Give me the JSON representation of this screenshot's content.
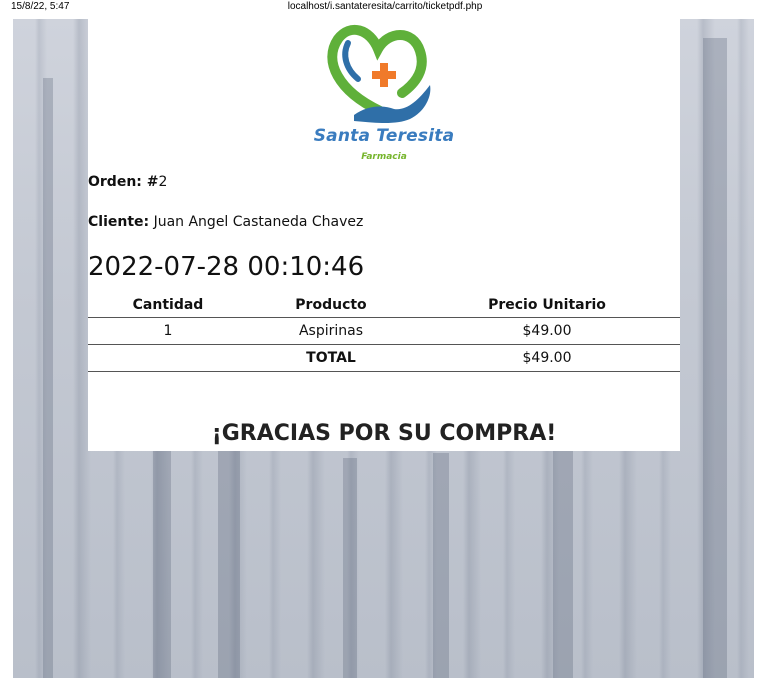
{
  "print_header": {
    "date": "15/8/22, 5:47",
    "url": "localhost/i.santateresita/carrito/ticketpdf.php"
  },
  "logo": {
    "brand": "Santa Teresita",
    "subtitle": "Farmacia",
    "colors": {
      "green": "#5fb03a",
      "blue": "#2f6fa8",
      "orange": "#f07a2a"
    }
  },
  "order": {
    "orden_label": "Orden: #",
    "orden_value": "2",
    "cliente_label": "Cliente:",
    "cliente_value": "Juan Angel Castaneda Chavez",
    "datetime": "2022-07-28 00:10:46"
  },
  "table": {
    "headers": [
      "Cantidad",
      "Producto",
      "Precio Unitario"
    ],
    "rows": [
      {
        "cantidad": "1",
        "producto": "Aspirinas",
        "precio": "$49.00"
      }
    ],
    "total_label": "TOTAL",
    "total_value": "$49.00"
  },
  "footer": {
    "thanks": "¡GRACIAS POR SU COMPRA!"
  }
}
